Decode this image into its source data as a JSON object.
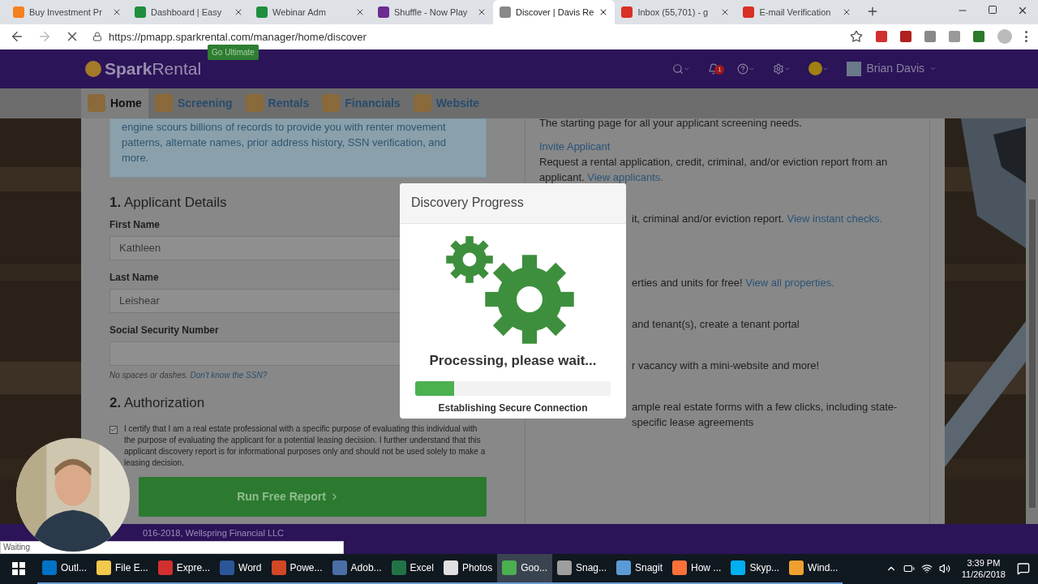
{
  "browser": {
    "tabs": [
      {
        "title": "Buy Investment Pr",
        "color": "#f4801f",
        "selected": false
      },
      {
        "title": "Dashboard | Easy",
        "color": "#1e8e3e",
        "selected": false
      },
      {
        "title": "Webinar Adm",
        "color": "#1e8e3e",
        "selected": false
      },
      {
        "title": "Shuffle - Now Play",
        "color": "#6a2c91",
        "selected": false
      },
      {
        "title": "Discover | Davis Re",
        "color": "#888888",
        "selected": true
      },
      {
        "title": "Inbox (55,701) - g",
        "color": "#d93025",
        "selected": false
      },
      {
        "title": "E-mail Verification",
        "color": "#d93025",
        "selected": false
      }
    ],
    "url": "https://pmapp.sparkrental.com/manager/home/discover"
  },
  "header": {
    "logo_a": "Spark",
    "logo_b": "Rental",
    "badge": "Go Ultimate",
    "notifications": "1",
    "user": "Brian Davis"
  },
  "nav": [
    {
      "label": "Home",
      "selected": true
    },
    {
      "label": "Screening",
      "selected": false
    },
    {
      "label": "Rentals",
      "selected": false
    },
    {
      "label": "Financials",
      "selected": false
    },
    {
      "label": "Website",
      "selected": false
    }
  ],
  "form": {
    "intro": "engine scours billions of records to provide you with renter movement patterns, alternate names, prior address history, SSN verification, and more.",
    "section1": "**1.** Applicant Details",
    "fields": [
      {
        "label": "First Name",
        "value": "Kathleen"
      },
      {
        "label": "Last Name",
        "value": "Leishear"
      },
      {
        "label": "Social Security Number"
      }
    ],
    "hint": "No spaces or dashes.",
    "hint_link": "Don't know the SSN?",
    "section2": "**2.** Authorization",
    "certify": {
      "checked": true,
      "text": "I certify that I am a real estate professional with a specific purpose of evaluating this individual with the purpose of evaluating the applicant for a potential leasing decision. I further understand that this applicant discovery report is for informational purposes only and should not be used solely to make a leasing decision."
    },
    "button": "Run Free Report"
  },
  "side": {
    "top": "The starting page for all your applicant screening needs.",
    "items": [
      {
        "kind": "full",
        "title": "Invite Applicant",
        "text": "Request a rental application, credit, criminal, and/or eviction report from an applicant.",
        "link": "View applicants."
      },
      {
        "kind": "covered",
        "text": "it, criminal and/or eviction report.",
        "link": "View instant checks."
      },
      {
        "kind": "covered",
        "text": "erties and units for free!",
        "link": "View all properties."
      },
      {
        "kind": "covered",
        "text": "and tenant(s), create a tenant portal"
      },
      {
        "kind": "covered",
        "text": "r vacancy with a mini-website and more!"
      },
      {
        "kind": "covered",
        "text": "ample real estate forms with a few clicks, including state-specific lease agreements"
      }
    ]
  },
  "footer": "016-2018, Wellspring Financial LLC",
  "status": "Waiting",
  "modal": {
    "title": "Discovery Progress",
    "message": "Processing, please wait...",
    "level": 0.2,
    "step": "Establishing Secure Connection"
  },
  "taskbar": {
    "apps": [
      {
        "label": "Outl...",
        "color": "#0072c6",
        "selected": false
      },
      {
        "label": "File E...",
        "color": "#f2c94c",
        "selected": false
      },
      {
        "label": "Expre...",
        "color": "#d32f2f",
        "selected": false
      },
      {
        "label": "Word",
        "color": "#2b579a",
        "selected": false
      },
      {
        "label": "Powe...",
        "color": "#d24726",
        "selected": false
      },
      {
        "label": "Adob...",
        "color": "#4a6fa5",
        "selected": false
      },
      {
        "label": "Excel",
        "color": "#217346",
        "selected": false
      },
      {
        "label": "Photos",
        "color": "#e0e0e0",
        "selected": false
      },
      {
        "label": "Goo...",
        "color": "#4caf50",
        "selected": true
      },
      {
        "label": "Snag...",
        "color": "#9e9e9e",
        "selected": false
      },
      {
        "label": "Snagit",
        "color": "#5b9bd5",
        "selected": false
      },
      {
        "label": "How ...",
        "color": "#ff7139",
        "selected": false
      },
      {
        "label": "Skyp...",
        "color": "#00aff0",
        "selected": false
      },
      {
        "label": "Wind...",
        "color": "#f0a030",
        "selected": false
      }
    ],
    "time": "3:39 PM",
    "date": "11/26/2018"
  }
}
